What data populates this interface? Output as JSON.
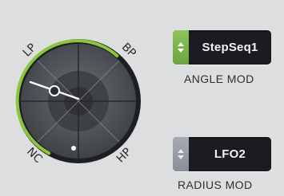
{
  "dial": {
    "labels": {
      "top_left": "LP",
      "top_right": "BP",
      "bottom_left": "NC",
      "bottom_right": "HP"
    },
    "colors": {
      "accent": "#8cc63f",
      "face": "#4a4d52",
      "rim": "#1e1f22"
    }
  },
  "angle_mod": {
    "value": "StepSeq1",
    "label": "ANGLE MOD",
    "active": true
  },
  "radius_mod": {
    "value": "LFO2",
    "label": "RADIUS MOD",
    "active": false
  }
}
